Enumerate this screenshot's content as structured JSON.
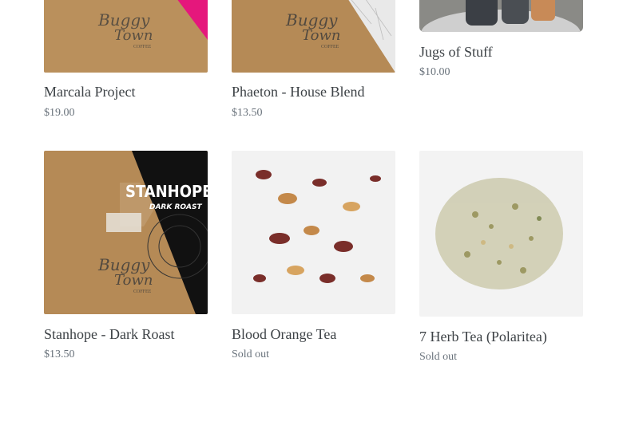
{
  "products": [
    {
      "title": "Marcala Project",
      "price": "$19.00",
      "image": "coffee-bag-pink"
    },
    {
      "title": "Phaeton - House Blend",
      "price": "$13.50",
      "image": "coffee-bag-marble"
    },
    {
      "title": "Jugs of Stuff",
      "price": "$10.00",
      "image": "jugs-photo"
    },
    {
      "title": "Stanhope - Dark Roast",
      "price": "$13.50",
      "image": "coffee-bag-dark",
      "label_top": "STANHOPE",
      "label_sub": "DARK ROAST"
    },
    {
      "title": "Blood Orange Tea",
      "price": "Sold out",
      "image": "blood-orange-tea-photo"
    },
    {
      "title": "7 Herb Tea (Polaritea)",
      "price": "Sold out",
      "image": "herb-tea-photo"
    }
  ],
  "brand": {
    "line1": "Buggy",
    "line2": "Town",
    "line3": "COFFEE"
  },
  "colors": {
    "bag": "#b58a56",
    "pink": "#e5177c",
    "dark": "#111111",
    "text": "#3d4246",
    "muted": "#69727b"
  }
}
